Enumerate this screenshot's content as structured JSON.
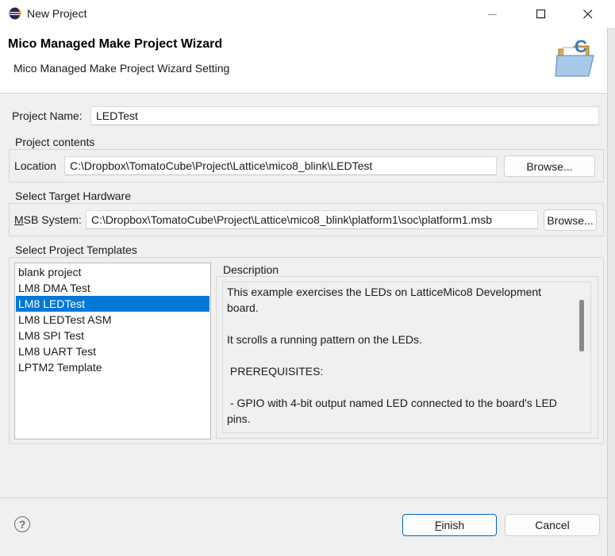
{
  "window": {
    "title": "New Project",
    "icon": "eclipse-icon"
  },
  "header": {
    "title": "Mico Managed Make Project Wizard",
    "subtitle": "Mico Managed Make Project Wizard Setting",
    "graphic": "c-project-folder-icon"
  },
  "form": {
    "project_name_label": "Project Name:",
    "project_name_value": "LEDTest",
    "project_contents": {
      "group_label": "Project contents",
      "location_label": "Location",
      "location_value": "C:\\Dropbox\\TomatoCube\\Project\\Lattice\\mico8_blink\\LEDTest",
      "browse_label": "Browse..."
    },
    "target_hardware": {
      "group_label": "Select Target Hardware",
      "msb_label_mnemonic": "M",
      "msb_label_rest": "SB System:",
      "msb_value": "C:\\Dropbox\\TomatoCube\\Project\\Lattice\\mico8_blink\\platform1\\soc\\platform1.msb",
      "browse_label": "Browse..."
    },
    "templates": {
      "group_label": "Select Project Templates",
      "items": [
        "blank project",
        "LM8 DMA Test",
        "LM8 LEDTest",
        "LM8 LEDTest ASM",
        "LM8 SPI Test",
        "LM8 UART Test",
        "LPTM2 Template"
      ],
      "selected_index": 2,
      "description_label": "Description",
      "description_lines": [
        "This example exercises the LEDs on LatticeMico8 Development board.",
        "",
        "It scrolls a running pattern on the LEDs.",
        "",
        " PREREQUISITES:",
        "",
        " - GPIO with 4-bit output named LED connected to the board's LED pins."
      ]
    }
  },
  "footer": {
    "help_icon": "?",
    "finish_mnemonic": "F",
    "finish_rest": "inish",
    "cancel_label": "Cancel"
  },
  "colors": {
    "selection": "#0078d7",
    "accent_border": "#0067c0"
  }
}
